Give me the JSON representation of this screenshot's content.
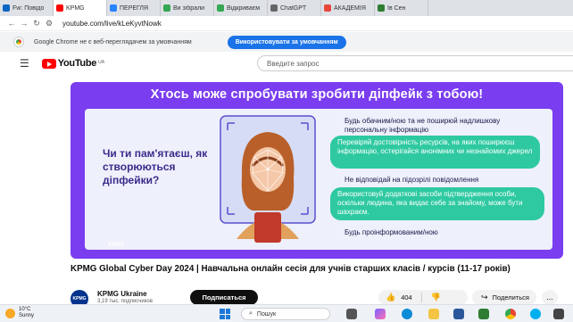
{
  "browser": {
    "tabs": [
      {
        "label": "Fw: Повідо",
        "color": "#0a66c2"
      },
      {
        "label": "KPMG",
        "color": "#ff0000"
      },
      {
        "label": "ПЕРЕГЛЯ",
        "color": "#2684fc"
      },
      {
        "label": "Ви зібрали",
        "color": "#34a853"
      },
      {
        "label": "Відкриваєм",
        "color": "#34a853"
      },
      {
        "label": "ChatGPT",
        "color": "#666666"
      },
      {
        "label": "АКАДЕМІЯ",
        "color": "#e8453c"
      },
      {
        "label": "Ів Сен",
        "color": "#2e7d32"
      }
    ],
    "url": "youtube.com/live/kLeKyvtNowk"
  },
  "infobar": {
    "text": "Google Chrome не є веб-переглядачем за умовчанням",
    "button": "Використовувати за умовчанням"
  },
  "youtube": {
    "logo_text": "YouTube",
    "region": "UA",
    "search_placeholder": "Введите запрос"
  },
  "slide": {
    "banner": "Хтось може спробувати зробити діпфейк з тобою!",
    "question": "Чи ти пам'ятаєш, як створюються діпфейки?",
    "tips": [
      "Будь обачним/ною та не поширюй надлишкову персональну інформацію",
      "Перевіряй достовірність ресурсів, на яких поширюєш інформацію, остерігайся анонімних чи незнайомих джерел",
      "Не відповідай на підозрілі повідомлення",
      "Використовуй додаткові засоби підтвердження особи, оскільки людина, яка видає себе за знайому, може бути шахраєм.",
      "Будь проінформованим/ною"
    ],
    "footer_brand": "KPMG"
  },
  "video": {
    "title": "KPMG Global Cyber Day 2024 | Навчальна онлайн сесія для учнів старших класів / курсів (11-17 років)",
    "channel": "KPMG Ukraine",
    "channel_avatar": "KPMG",
    "subscribers": "3,19 тыс. подписчиков",
    "subscribe": "Подписаться",
    "likes": "404",
    "share": "Поделиться",
    "more": "..."
  },
  "taskbar": {
    "temperature": "10°C",
    "weather": "Sunny",
    "search": "Пошук"
  },
  "icons": {
    "menu": "hamburger-menu-icon",
    "like": "thumb-up-icon",
    "dislike": "thumb-down-icon",
    "share": "share-icon"
  }
}
